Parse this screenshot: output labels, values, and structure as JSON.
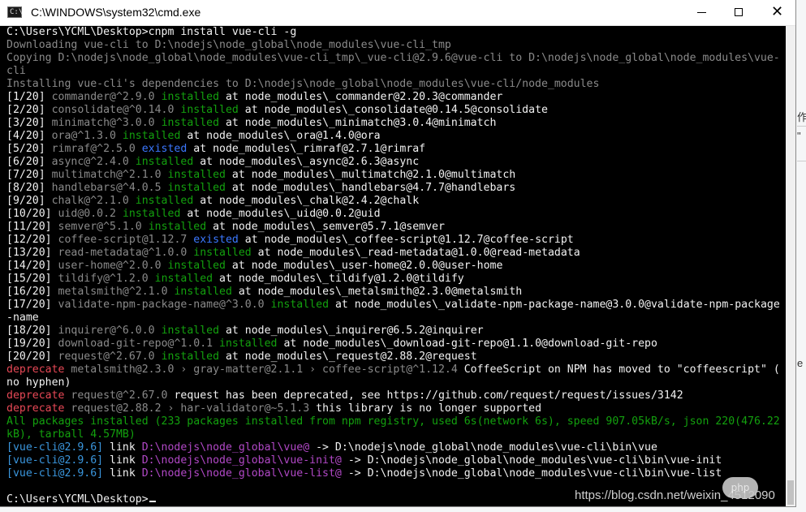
{
  "window": {
    "title": "C:\\WINDOWS\\system32\\cmd.exe",
    "icon_label": "C:\\",
    "close_glyph": "✕"
  },
  "colors": {
    "white": "#f2f2f2",
    "dim": "#8a8a8a",
    "green": "#13a10e",
    "blue": "#3b78ff",
    "red": "#e74856",
    "magenta": "#b148c6",
    "cyan": "#3a96dd"
  },
  "console": {
    "lines": [
      [
        [
          "w",
          "C:\\Users\\YCML\\Desktop>cnpm install vue-cli -g"
        ]
      ],
      [
        [
          "d",
          "Downloading vue-cli to D:\\nodejs\\node_global\\node_modules\\vue-cli_tmp"
        ]
      ],
      [
        [
          "d",
          "Copying D:\\nodejs\\node_global\\node_modules\\vue-cli_tmp\\_vue-cli@2.9.6@vue-cli to D:\\nodejs\\node_global\\node_modules\\vue-"
        ]
      ],
      [
        [
          "d",
          "cli"
        ]
      ],
      [
        [
          "d",
          "Installing vue-cli's dependencies to D:\\nodejs\\node_global\\node_modules\\vue-cli/node_modules"
        ]
      ],
      [
        [
          "w",
          "[1/20] "
        ],
        [
          "d",
          "commander@^2.9.0 "
        ],
        [
          "g",
          "installed"
        ],
        [
          "w",
          " at node_modules\\_commander@2.20.3@commander"
        ]
      ],
      [
        [
          "w",
          "[2/20] "
        ],
        [
          "d",
          "consolidate@^0.14.0 "
        ],
        [
          "g",
          "installed"
        ],
        [
          "w",
          " at node_modules\\_consolidate@0.14.5@consolidate"
        ]
      ],
      [
        [
          "w",
          "[3/20] "
        ],
        [
          "d",
          "minimatch@^3.0.0 "
        ],
        [
          "g",
          "installed"
        ],
        [
          "w",
          " at node_modules\\_minimatch@3.0.4@minimatch"
        ]
      ],
      [
        [
          "w",
          "[4/20] "
        ],
        [
          "d",
          "ora@^1.3.0 "
        ],
        [
          "g",
          "installed"
        ],
        [
          "w",
          " at node_modules\\_ora@1.4.0@ora"
        ]
      ],
      [
        [
          "w",
          "[5/20] "
        ],
        [
          "d",
          "rimraf@^2.5.0 "
        ],
        [
          "b",
          "existed"
        ],
        [
          "w",
          " at node_modules\\_rimraf@2.7.1@rimraf"
        ]
      ],
      [
        [
          "w",
          "[6/20] "
        ],
        [
          "d",
          "async@^2.4.0 "
        ],
        [
          "g",
          "installed"
        ],
        [
          "w",
          " at node_modules\\_async@2.6.3@async"
        ]
      ],
      [
        [
          "w",
          "[7/20] "
        ],
        [
          "d",
          "multimatch@^2.1.0 "
        ],
        [
          "g",
          "installed"
        ],
        [
          "w",
          " at node_modules\\_multimatch@2.1.0@multimatch"
        ]
      ],
      [
        [
          "w",
          "[8/20] "
        ],
        [
          "d",
          "handlebars@^4.0.5 "
        ],
        [
          "g",
          "installed"
        ],
        [
          "w",
          " at node_modules\\_handlebars@4.7.7@handlebars"
        ]
      ],
      [
        [
          "w",
          "[9/20] "
        ],
        [
          "d",
          "chalk@^2.1.0 "
        ],
        [
          "g",
          "installed"
        ],
        [
          "w",
          " at node_modules\\_chalk@2.4.2@chalk"
        ]
      ],
      [
        [
          "w",
          "[10/20] "
        ],
        [
          "d",
          "uid@0.0.2 "
        ],
        [
          "g",
          "installed"
        ],
        [
          "w",
          " at node_modules\\_uid@0.0.2@uid"
        ]
      ],
      [
        [
          "w",
          "[11/20] "
        ],
        [
          "d",
          "semver@^5.1.0 "
        ],
        [
          "g",
          "installed"
        ],
        [
          "w",
          " at node_modules\\_semver@5.7.1@semver"
        ]
      ],
      [
        [
          "w",
          "[12/20] "
        ],
        [
          "d",
          "coffee-script@1.12.7 "
        ],
        [
          "b",
          "existed"
        ],
        [
          "w",
          " at node_modules\\_coffee-script@1.12.7@coffee-script"
        ]
      ],
      [
        [
          "w",
          "[13/20] "
        ],
        [
          "d",
          "read-metadata@^1.0.0 "
        ],
        [
          "g",
          "installed"
        ],
        [
          "w",
          " at node_modules\\_read-metadata@1.0.0@read-metadata"
        ]
      ],
      [
        [
          "w",
          "[14/20] "
        ],
        [
          "d",
          "user-home@^2.0.0 "
        ],
        [
          "g",
          "installed"
        ],
        [
          "w",
          " at node_modules\\_user-home@2.0.0@user-home"
        ]
      ],
      [
        [
          "w",
          "[15/20] "
        ],
        [
          "d",
          "tildify@^1.2.0 "
        ],
        [
          "g",
          "installed"
        ],
        [
          "w",
          " at node_modules\\_tildify@1.2.0@tildify"
        ]
      ],
      [
        [
          "w",
          "[16/20] "
        ],
        [
          "d",
          "metalsmith@^2.1.0 "
        ],
        [
          "g",
          "installed"
        ],
        [
          "w",
          " at node_modules\\_metalsmith@2.3.0@metalsmith"
        ]
      ],
      [
        [
          "w",
          "[17/20] "
        ],
        [
          "d",
          "validate-npm-package-name@^3.0.0 "
        ],
        [
          "g",
          "installed"
        ],
        [
          "w",
          " at node_modules\\_validate-npm-package-name@3.0.0@validate-npm-package"
        ]
      ],
      [
        [
          "w",
          "-name"
        ]
      ],
      [
        [
          "w",
          "[18/20] "
        ],
        [
          "d",
          "inquirer@^6.0.0 "
        ],
        [
          "g",
          "installed"
        ],
        [
          "w",
          " at node_modules\\_inquirer@6.5.2@inquirer"
        ]
      ],
      [
        [
          "w",
          "[19/20] "
        ],
        [
          "d",
          "download-git-repo@^1.0.1 "
        ],
        [
          "g",
          "installed"
        ],
        [
          "w",
          " at node_modules\\_download-git-repo@1.1.0@download-git-repo"
        ]
      ],
      [
        [
          "w",
          "[20/20] "
        ],
        [
          "d",
          "request@^2.67.0 "
        ],
        [
          "g",
          "installed"
        ],
        [
          "w",
          " at node_modules\\_request@2.88.2@request"
        ]
      ],
      [
        [
          "r",
          "deprecate"
        ],
        [
          "d",
          " metalsmith@2.3.0 › gray-matter@2.1.1 › coffee-script@^1.12.4 "
        ],
        [
          "w",
          "CoffeeScript on NPM has moved to \"coffeescript\" ("
        ]
      ],
      [
        [
          "w",
          "no hyphen)"
        ]
      ],
      [
        [
          "r",
          "deprecate"
        ],
        [
          "d",
          " request@^2.67.0 "
        ],
        [
          "w",
          "request has been deprecated, see https://github.com/request/request/issues/3142"
        ]
      ],
      [
        [
          "r",
          "deprecate"
        ],
        [
          "d",
          " request@2.88.2 › har-validator@~5.1.3 "
        ],
        [
          "w",
          "this library is no longer supported"
        ]
      ],
      [
        [
          "g",
          "All packages installed (233 packages installed from npm registry, used 6s(network 6s), speed 907.05kB/s, json 220(476.22"
        ]
      ],
      [
        [
          "g",
          "kB), tarball 4.57MB)"
        ]
      ],
      [
        [
          "c",
          "[vue-cli@2.9.6]"
        ],
        [
          "w",
          " link "
        ],
        [
          "m",
          "D:\\nodejs\\node_global\\vue@"
        ],
        [
          "w",
          " -> D:\\nodejs\\node_global\\node_modules\\vue-cli\\bin\\vue"
        ]
      ],
      [
        [
          "c",
          "[vue-cli@2.9.6]"
        ],
        [
          "w",
          " link "
        ],
        [
          "m",
          "D:\\nodejs\\node_global\\vue-init@"
        ],
        [
          "w",
          " -> D:\\nodejs\\node_global\\node_modules\\vue-cli\\bin\\vue-init"
        ]
      ],
      [
        [
          "c",
          "[vue-cli@2.9.6]"
        ],
        [
          "w",
          " link "
        ],
        [
          "m",
          "D:\\nodejs\\node_global\\vue-list@"
        ],
        [
          "w",
          " -> D:\\nodejs\\node_global\\node_modules\\vue-cli\\bin\\vue-list"
        ]
      ],
      [
        [
          "w",
          ""
        ]
      ],
      [
        [
          "w",
          "C:\\Users\\YCML\\Desktop>"
        ]
      ]
    ]
  },
  "watermark": {
    "text": "https://blog.csdn.net/weixin_4512090",
    "logo": "php"
  },
  "side": {
    "char1": "作",
    "char2": "\"",
    "char3": "e"
  }
}
